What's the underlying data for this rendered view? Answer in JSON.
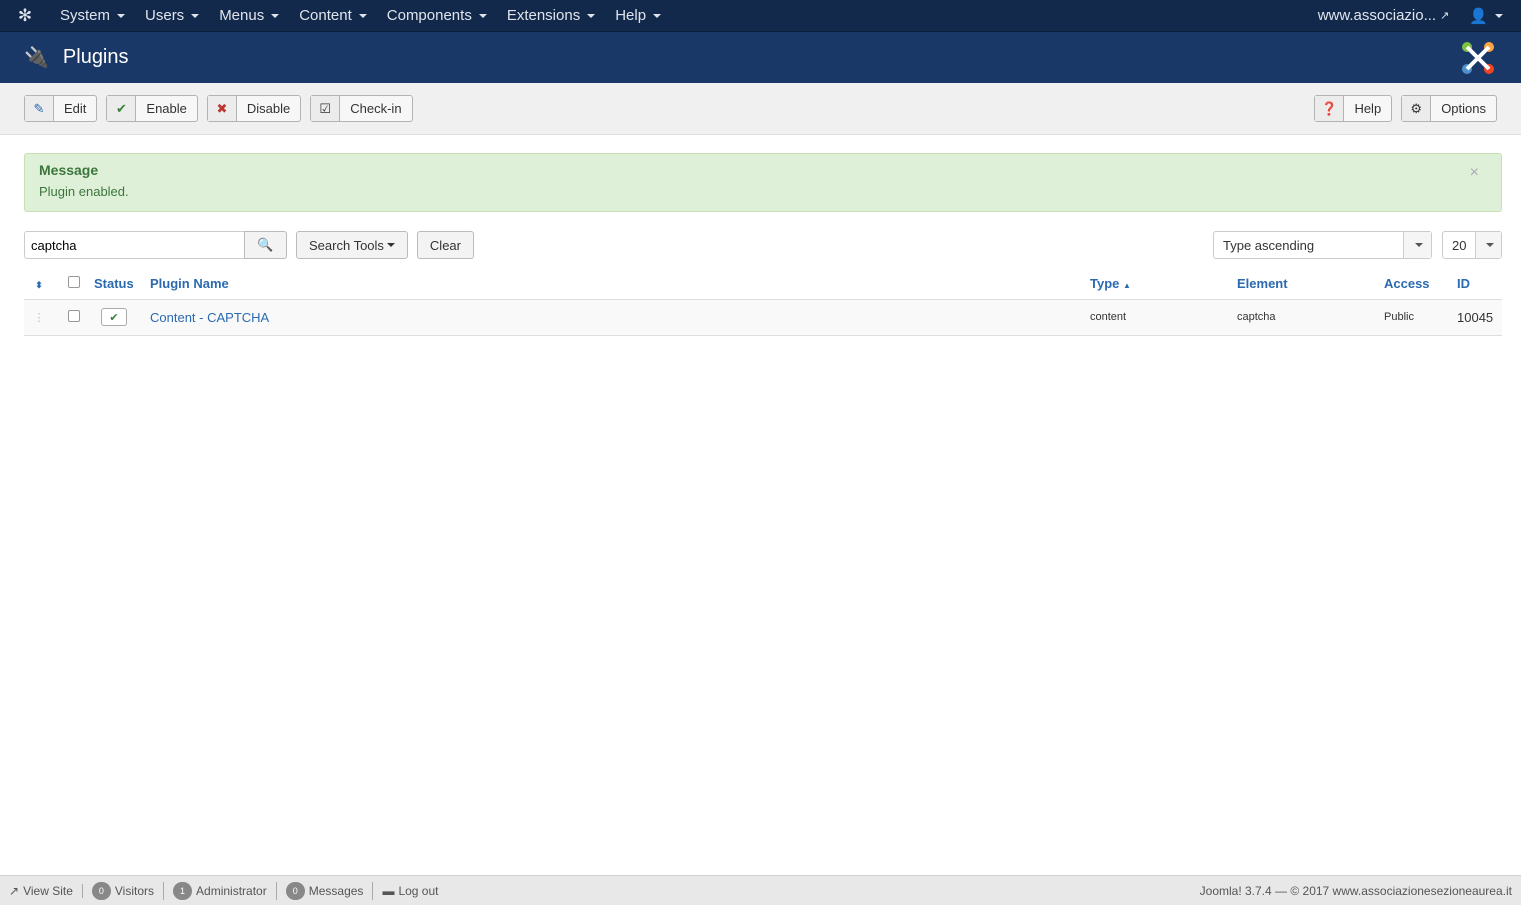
{
  "topnav": {
    "menus": [
      "System",
      "Users",
      "Menus",
      "Content",
      "Components",
      "Extensions",
      "Help"
    ],
    "site": "www.associazio..."
  },
  "header": {
    "title": "Plugins",
    "brand": "Joomla!"
  },
  "toolbar": {
    "edit": "Edit",
    "enable": "Enable",
    "disable": "Disable",
    "checkin": "Check-in",
    "help": "Help",
    "options": "Options"
  },
  "message": {
    "title": "Message",
    "text": "Plugin enabled.",
    "close": "×"
  },
  "filters": {
    "search_value": "captcha",
    "search_tools": "Search Tools",
    "clear": "Clear",
    "ordering": "Type ascending",
    "limit": "20"
  },
  "table": {
    "headers": {
      "status": "Status",
      "name": "Plugin Name",
      "type": "Type",
      "element": "Element",
      "access": "Access",
      "id": "ID"
    },
    "rows": [
      {
        "name": "Content - CAPTCHA",
        "type": "content",
        "element": "captcha",
        "access": "Public",
        "id": "10045",
        "enabled": true
      }
    ]
  },
  "footer": {
    "view_site": "View Site",
    "visitors_count": "0",
    "visitors": "Visitors",
    "admin_count": "1",
    "admin": "Administrator",
    "messages_count": "0",
    "messages": "Messages",
    "logout": "Log out",
    "copyright": "Joomla! 3.7.4  —  © 2017 www.associazionesezioneaurea.it"
  },
  "colors": {
    "nav": "#13294b",
    "header": "#1a3867",
    "link": "#2a6ab0",
    "success_bg": "#dff0d8"
  }
}
